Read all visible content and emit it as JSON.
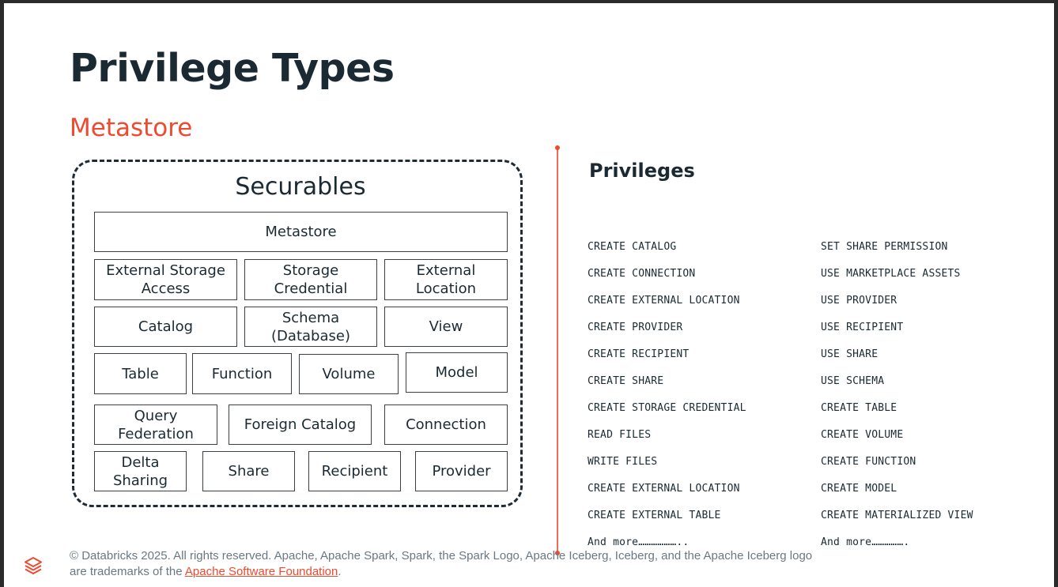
{
  "title": "Privilege Types",
  "subtitle": "Metastore",
  "securables": {
    "title": "Securables",
    "rows": [
      [
        "Metastore"
      ],
      [
        "External Storage Access",
        "Storage Credential",
        "External Location"
      ],
      [
        "Catalog",
        "Schema (Database)",
        "View"
      ],
      [
        "Table",
        "Function",
        "Volume",
        "Model"
      ],
      [
        "Query Federation",
        "Foreign Catalog",
        "Connection"
      ],
      [
        "Delta Sharing",
        "Share",
        "Recipient",
        "Provider"
      ]
    ]
  },
  "privileges": {
    "heading": "Privileges",
    "column_1": [
      "CREATE CATALOG",
      "CREATE CONNECTION",
      "CREATE EXTERNAL LOCATION",
      "CREATE PROVIDER",
      "CREATE RECIPIENT",
      "CREATE SHARE",
      "CREATE STORAGE CREDENTIAL",
      "READ FILES",
      "WRITE FILES",
      "CREATE EXTERNAL LOCATION",
      "CREATE EXTERNAL TABLE",
      "And more……………….."
    ],
    "column_2": [
      "SET SHARE PERMISSION",
      "USE MARKETPLACE ASSETS",
      "USE PROVIDER",
      "USE RECIPIENT",
      "USE SHARE",
      "USE SCHEMA",
      "CREATE TABLE",
      "CREATE VOLUME",
      "CREATE FUNCTION",
      "CREATE MODEL",
      "CREATE MATERIALIZED VIEW",
      "And more……………."
    ]
  },
  "footer": {
    "text": "© Databricks 2025. All rights reserved. Apache, Apache Spark, Spark, the Spark Logo, Apache Iceberg, Iceberg, and the Apache Iceberg logo are trademarks of the ",
    "link": "Apache Software Foundation",
    "suffix": ".",
    "logo_icon": "databricks-logo-icon"
  },
  "colors": {
    "accent": "#ee4a2f",
    "text": "#1b2a32",
    "footer_text": "#6a7882"
  }
}
